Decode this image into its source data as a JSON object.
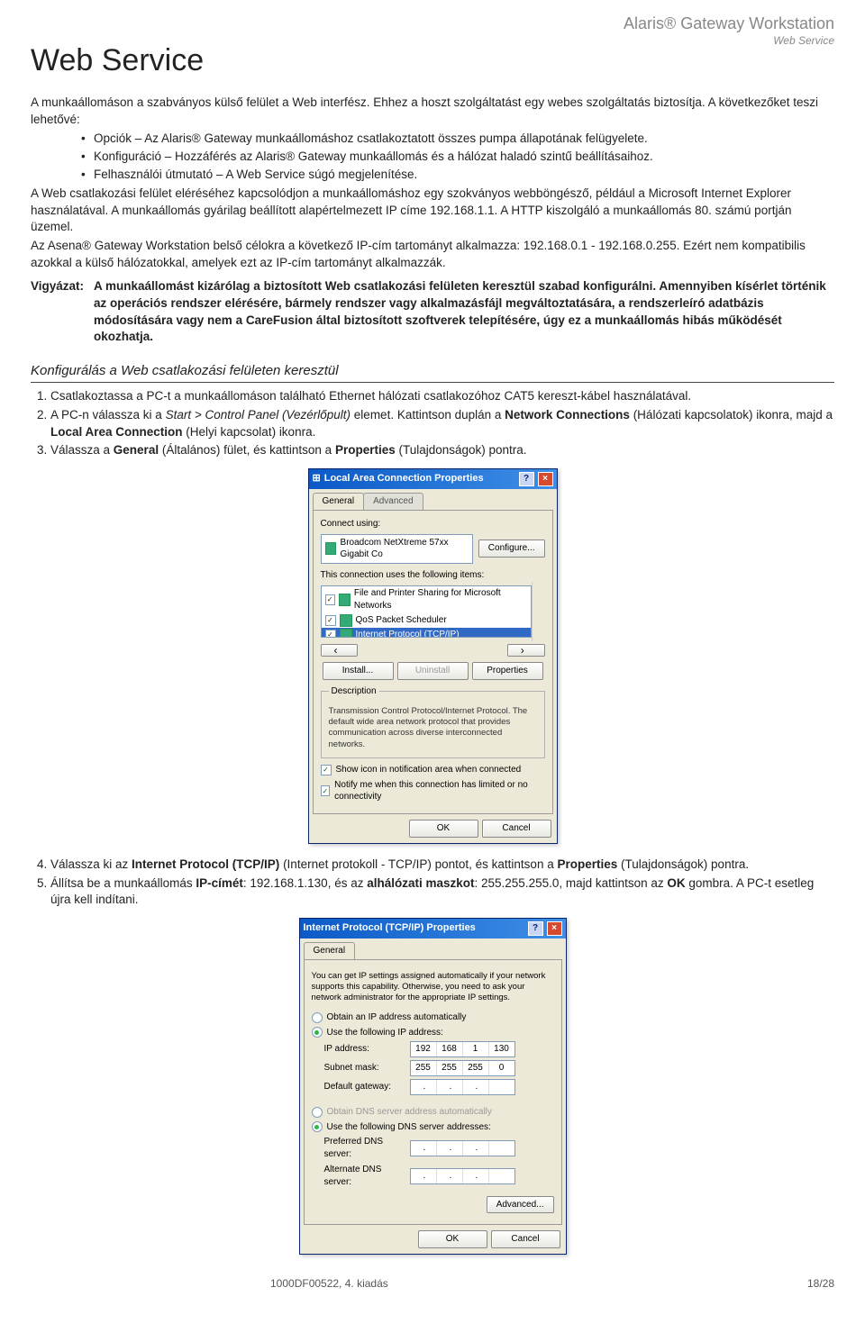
{
  "header": {
    "product": "Alaris® Gateway Workstation",
    "section": "Web Service"
  },
  "title": "Web Service",
  "intro1": "A munkaállomáson a szabványos külső felület a Web interfész. Ehhez a hoszt szolgáltatást egy webes szolgáltatás biztosítja. A következőket teszi lehetővé:",
  "bullets": [
    "Opciók – Az Alaris® Gateway munkaállomáshoz csatlakoztatott összes pumpa állapotának felügyelete.",
    "Konfiguráció – Hozzáférés az Alaris® Gateway munkaállomás és a hálózat haladó szintű beállításaihoz.",
    "Felhasználói útmutató – A Web Service súgó megjelenítése."
  ],
  "intro2": "A Web csatlakozási felület eléréséhez kapcsolódjon a munkaállomáshoz egy szokványos webböngésző, például a Microsoft Internet Explorer használatával. A munkaállomás gyárilag beállított alapértelmezett IP címe 192.168.1.1. A HTTP kiszolgáló a munkaállomás 80. számú portján üzemel.",
  "intro3": "Az Asena® Gateway Workstation belső célokra a következő IP-cím tartományt alkalmazza: 192.168.0.1 - 192.168.0.255. Ezért nem kompatibilis azokkal a külső hálózatokkal, amelyek ezt az IP-cím tartományt alkalmazzák.",
  "warning": {
    "label": "Vigyázat:",
    "text": "A munkaállomást kizárólag a biztosított Web csatlakozási felületen keresztül szabad konfigurálni. Amennyiben kísérlet történik az operációs rendszer elérésére, bármely rendszer vagy alkalmazásfájl megváltoztatására, a rendszerleíró adatbázis módosítására vagy nem a CareFusion által biztosított szoftverek telepítésére, úgy ez a munkaállomás hibás működését okozhatja."
  },
  "subheading": "Konfigurálás a Web csatlakozási felületen keresztül",
  "steps_a": [
    "Csatlakoztassa a PC-t a munkaállomáson található Ethernet hálózati csatlakozóhoz CAT5 kereszt-kábel használatával.",
    "A PC-n válassza ki a {i}Start > Control Panel (Vezérlőpult){/i} elemet. Kattintson duplán a {b}Network Connections{/b} (Hálózati kapcsolatok) ikonra, majd a {b}Local Area Connection{/b} (Helyi kapcsolat) ikonra.",
    "Válassza a {b}General{/b} (Általános) fület, és kattintson a {b}Properties{/b} (Tulajdonságok) pontra."
  ],
  "steps_b": [
    "Válassza ki az {b}Internet Protocol (TCP/IP){/b} (Internet protokoll - TCP/IP) pontot, és kattintson a {b}Properties{/b} (Tulajdonságok) pontra.",
    "Állítsa be a munkaállomás {b}IP-címét{/b}: 192.168.1.130, és az {b}alhálózati maszkot{/b}: 255.255.255.0, majd kattintson az {b}OK{/b} gombra. A PC-t esetleg újra kell indítani."
  ],
  "dlg1": {
    "title": "Local Area Connection Properties",
    "tabs": [
      "General",
      "Advanced"
    ],
    "connect_using_label": "Connect using:",
    "nic": "Broadcom NetXtreme 57xx Gigabit Co",
    "configure": "Configure...",
    "items_label": "This connection uses the following items:",
    "items": [
      {
        "checked": true,
        "label": "File and Printer Sharing for Microsoft Networks"
      },
      {
        "checked": true,
        "label": "QoS Packet Scheduler"
      },
      {
        "checked": true,
        "label": "Internet Protocol (TCP/IP)",
        "selected": true
      }
    ],
    "buttons": {
      "install": "Install...",
      "uninstall": "Uninstall",
      "properties": "Properties"
    },
    "desc_h": "Description",
    "desc": "Transmission Control Protocol/Internet Protocol. The default wide area network protocol that provides communication across diverse interconnected networks.",
    "show_icon": "Show icon in notification area when connected",
    "notify": "Notify me when this connection has limited or no connectivity",
    "ok": "OK",
    "cancel": "Cancel"
  },
  "dlg2": {
    "title": "Internet Protocol (TCP/IP) Properties",
    "tab": "General",
    "prolog": "You can get IP settings assigned automatically if your network supports this capability. Otherwise, you need to ask your network administrator for the appropriate IP settings.",
    "r_obtain_ip": "Obtain an IP address automatically",
    "r_use_ip": "Use the following IP address:",
    "ip_label": "IP address:",
    "ip": [
      "192",
      "168",
      "1",
      "130"
    ],
    "subnet_label": "Subnet mask:",
    "subnet": [
      "255",
      "255",
      "255",
      "0"
    ],
    "gw_label": "Default gateway:",
    "gw": [
      "",
      "",
      "",
      ""
    ],
    "r_obtain_dns": "Obtain DNS server address automatically",
    "r_use_dns": "Use the following DNS server addresses:",
    "pref_dns": "Preferred DNS server:",
    "alt_dns": "Alternate DNS server:",
    "advanced": "Advanced...",
    "ok": "OK",
    "cancel": "Cancel"
  },
  "footer": {
    "left": "1000DF00522, 4. kiadás",
    "right": "18/28"
  }
}
